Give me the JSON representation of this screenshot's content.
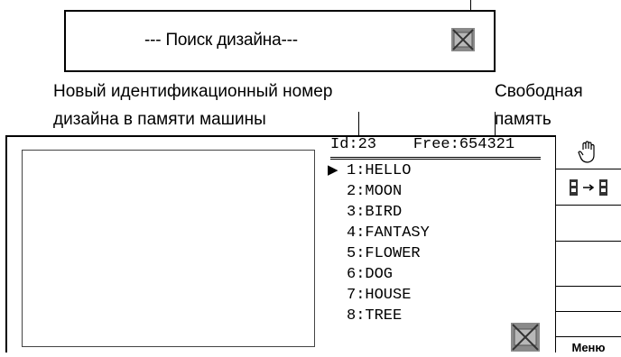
{
  "search_callout": {
    "title": "--- Поиск дизайна---",
    "icon": "disabled-crossed-icon"
  },
  "annotations": {
    "id_label_line1": "Новый идентификационный номер",
    "id_label_line2": "дизайна в памяти машины",
    "free_label_line1": "Свободная",
    "free_label_line2": "память"
  },
  "screen": {
    "id_text": "Id:23",
    "free_text": "Free:654321",
    "selected_marker": "▶",
    "designs": [
      {
        "label": "1:HELLO"
      },
      {
        "label": "2:MOON"
      },
      {
        "label": "3:BIRD"
      },
      {
        "label": "4:FANTASY"
      },
      {
        "label": "5:FLOWER"
      },
      {
        "label": "6:DOG"
      },
      {
        "label": "7:HOUSE"
      },
      {
        "label": "8:TREE"
      }
    ],
    "selected_index": 0,
    "sidebar_icons": [
      "hand-pointer-icon",
      "machine-to-machine-icon"
    ],
    "bottom_icon": "disabled-crossed-icon",
    "menu_label": "Меню"
  }
}
